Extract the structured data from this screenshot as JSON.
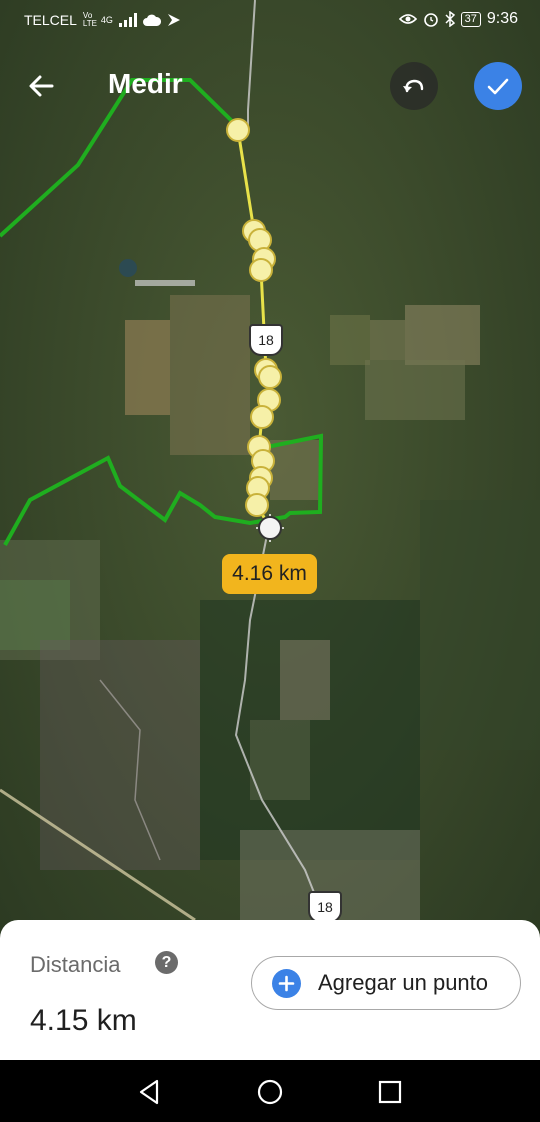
{
  "status_bar": {
    "carrier": "TELCEL",
    "network_badge": "Vo LTE",
    "network_type": "4G",
    "battery": "37",
    "time": "9:36",
    "icons": [
      "signal-icon",
      "cloud-icon",
      "flag-icon",
      "eye-icon",
      "alarm-icon",
      "bluetooth-icon",
      "battery-icon"
    ]
  },
  "toolbar": {
    "title": "Medir",
    "back_icon": "arrow-left-icon",
    "undo_icon": "undo-icon",
    "done_icon": "check-icon"
  },
  "map": {
    "type": "satellite",
    "route_shields": [
      "18",
      "18"
    ],
    "measure_label": "4.16 km",
    "colors": {
      "boundary_line": "#1fae1f",
      "measure_line": "#e8e24a",
      "measure_point": "#f6f0a8",
      "label_bg": "#f2b51d"
    }
  },
  "panel": {
    "distance_label": "Distancia",
    "help_icon": "?",
    "distance_value": "4.15 km",
    "add_point_label": "Agregar un punto",
    "accent": "#3b82e6"
  },
  "nav_bar": {
    "icons": [
      "back-triangle-icon",
      "home-circle-icon",
      "recents-square-icon"
    ]
  }
}
